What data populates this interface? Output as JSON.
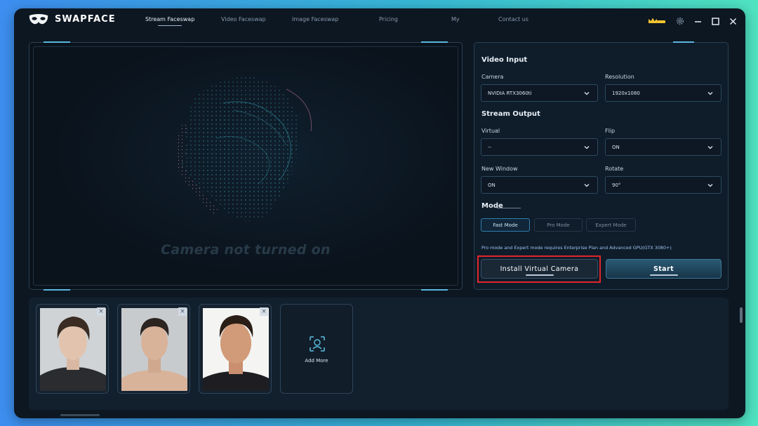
{
  "app": {
    "name": "SWAPFACE"
  },
  "nav": {
    "items": [
      {
        "label": "Stream Faceswap",
        "active": true
      },
      {
        "label": "Video Faceswap",
        "active": false
      },
      {
        "label": "Image Faceswap",
        "active": false
      },
      {
        "label": "Pricing",
        "active": false
      },
      {
        "label": "My",
        "active": false
      },
      {
        "label": "Contact us",
        "active": false
      }
    ]
  },
  "window_controls": [
    "crown-icon",
    "gear-icon",
    "minimize-icon",
    "maximize-icon",
    "close-icon"
  ],
  "preview": {
    "status": "Camera not turned on"
  },
  "video_input": {
    "title": "Video Input",
    "camera_label": "Camera",
    "camera_value": "NVIDIA RTX3060ti",
    "resolution_label": "Resolution",
    "resolution_value": "1920x1080"
  },
  "stream_output": {
    "title": "Stream Output",
    "virtual_label": "Virtual",
    "virtual_value": "--",
    "flip_label": "Flip",
    "flip_value": "ON",
    "new_window_label": "New Window",
    "new_window_value": "ON",
    "rotate_label": "Rotate",
    "rotate_value": "90°"
  },
  "mode": {
    "title": "Mode",
    "options": [
      "Fast Mode",
      "Pro Mode",
      "Expert Mode"
    ],
    "selected": "Fast Mode",
    "note": "Pro mode and Expert mode requires Enterprise Plan and Advanced GPU(GTX 3080+)"
  },
  "actions": {
    "install_label": "Install Virtual Camera",
    "start_label": "Start"
  },
  "faces": {
    "add_more_label": "Add More"
  },
  "colors": {
    "background": "#0d1722",
    "accent": "#59b7df",
    "highlight": "#e0262b",
    "note_text": "#9ec3ef"
  }
}
